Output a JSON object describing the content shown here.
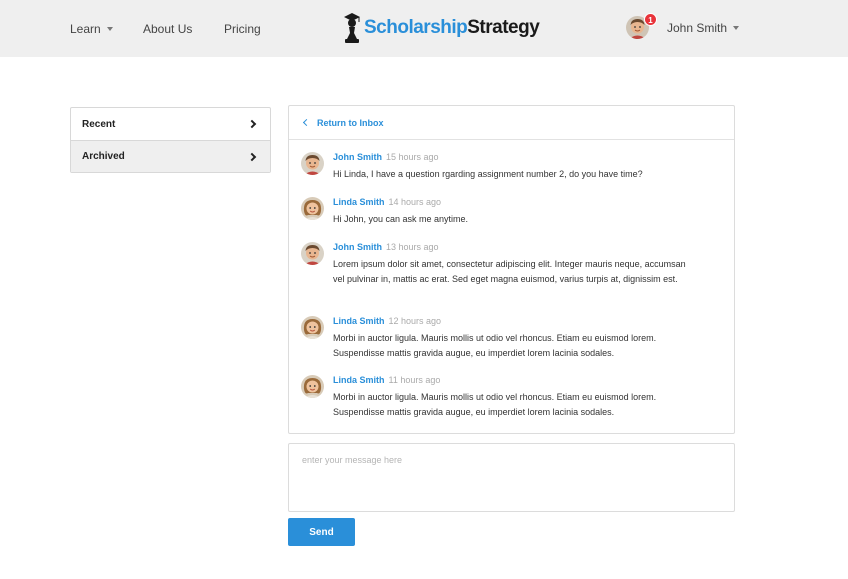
{
  "nav": {
    "learn": "Learn",
    "about": "About Us",
    "pricing": "Pricing"
  },
  "brand": {
    "part1": "Scholarship",
    "part2": "Strategy",
    "color_primary": "#2a8fd9",
    "color_dark": "#1a1a1a",
    "icon": "chess-pawn-graduation-cap-icon"
  },
  "user": {
    "name": "John Smith",
    "notification_count": "1"
  },
  "sidebar": {
    "items": [
      {
        "label": "Recent"
      },
      {
        "label": "Archived"
      }
    ]
  },
  "thread": {
    "back_label": "Return to Inbox",
    "messages": [
      {
        "author": "John Smith",
        "time": "15 hours ago",
        "text": "Hi Linda, I have a question rgarding assignment number 2, do you have time?"
      },
      {
        "author": "Linda Smith",
        "time": "14 hours ago",
        "text": "Hi John, you can ask me anytime."
      },
      {
        "author": "John Smith",
        "time": "13 hours ago",
        "text": "Lorem ipsum dolor sit amet, consectetur adipiscing elit. Integer mauris neque, accumsan vel pulvinar in, mattis ac erat. Sed eget magna euismod, varius turpis at, dignissim est."
      },
      {
        "author": "Linda Smith",
        "time": "12 hours ago",
        "text": "Morbi in auctor ligula. Mauris mollis ut odio vel rhoncus. Etiam eu euismod lorem. Suspendisse mattis gravida augue, eu imperdiet lorem lacinia sodales."
      },
      {
        "author": "Linda Smith",
        "time": "11 hours ago",
        "text": "Morbi in auctor ligula. Mauris mollis ut odio vel rhoncus. Etiam eu euismod lorem. Suspendisse mattis gravida augue, eu imperdiet lorem lacinia sodales."
      }
    ]
  },
  "composer": {
    "placeholder": "enter your message here",
    "value": "",
    "send_label": "Send"
  }
}
